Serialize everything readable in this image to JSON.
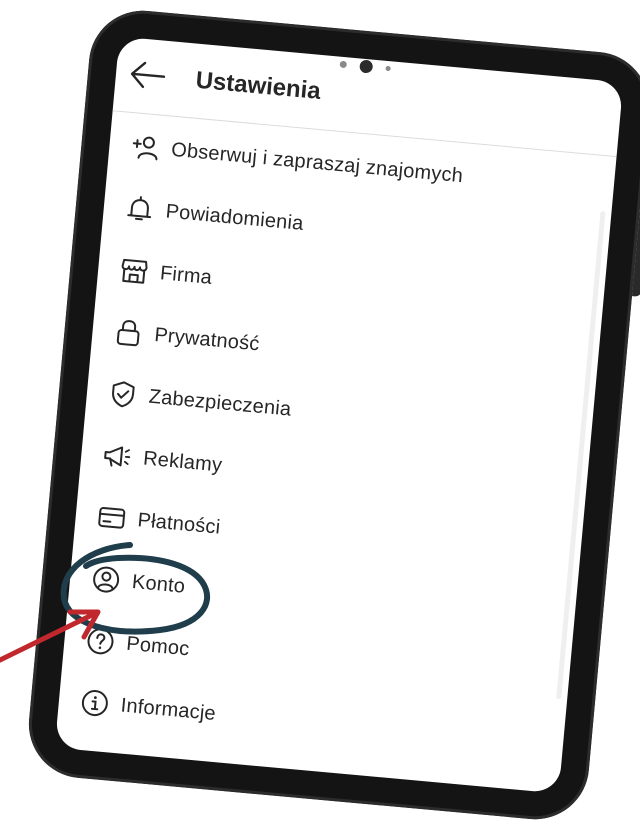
{
  "header": {
    "title": "Ustawienia",
    "back_icon": "arrow-left-icon"
  },
  "menu": [
    {
      "label": "Obserwuj i zapraszaj znajomych",
      "icon": "add-person-icon"
    },
    {
      "label": "Powiadomienia",
      "icon": "bell-icon"
    },
    {
      "label": "Firma",
      "icon": "shop-icon"
    },
    {
      "label": "Prywatność",
      "icon": "lock-icon"
    },
    {
      "label": "Zabezpieczenia",
      "icon": "shield-check-icon"
    },
    {
      "label": "Reklamy",
      "icon": "megaphone-icon"
    },
    {
      "label": "Płatności",
      "icon": "card-icon"
    },
    {
      "label": "Konto",
      "icon": "account-icon"
    },
    {
      "label": "Pomoc",
      "icon": "help-icon"
    },
    {
      "label": "Informacje",
      "icon": "info-icon"
    }
  ],
  "highlight": {
    "target": "Konto",
    "circle_color": "#1f3d4a",
    "arrow_color": "#c0282d"
  }
}
